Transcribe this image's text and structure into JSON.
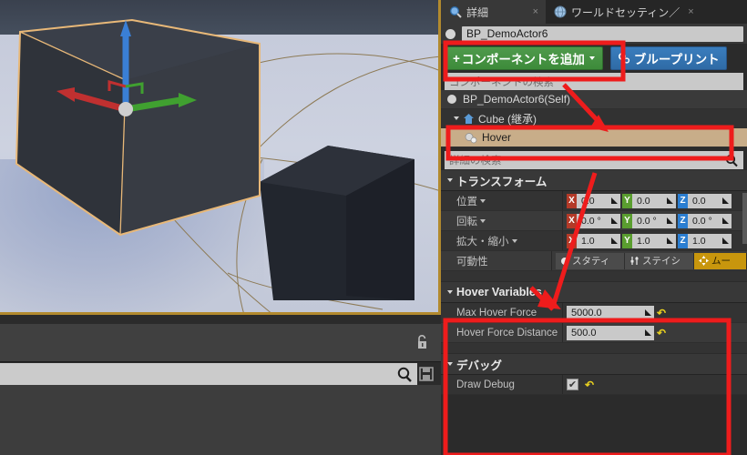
{
  "tabs": [
    {
      "label": "詳細",
      "icon": "details-magnifier-icon",
      "active": true,
      "close": "×"
    },
    {
      "label": "ワールドセッティン／",
      "icon": "globe-icon",
      "active": false,
      "close": "×"
    }
  ],
  "actor": {
    "name": "BP_DemoActor6",
    "icon": "sphere-icon"
  },
  "toolbar": {
    "add_component_label": "コンポーネントを追加",
    "add_component_plus": "+",
    "blueprint_label": "ブループリント",
    "blueprint_icon": "gears-icon"
  },
  "component_search_placeholder": "コンポーネントの検索",
  "component_tree": [
    {
      "label": "BP_DemoActor6(Self)",
      "icon": "sphere-icon",
      "level": "root",
      "selected": false
    },
    {
      "label": "Cube (継承)",
      "icon": "home-icon",
      "level": "child",
      "selected": false
    },
    {
      "label": "Hover",
      "icon": "spheres-icon",
      "level": "sub",
      "selected": true
    }
  ],
  "details_search_placeholder": "詳細の検索",
  "details_search_icon": "magnifier-icon",
  "sections": {
    "transform": {
      "title": "トランスフォーム",
      "rows": [
        {
          "label": "位置",
          "dropdown": true,
          "type": "vector",
          "axes": [
            {
              "axis": "X",
              "value": "0.0"
            },
            {
              "axis": "Y",
              "value": "0.0"
            },
            {
              "axis": "Z",
              "value": "0.0"
            }
          ]
        },
        {
          "label": "回転",
          "dropdown": true,
          "type": "vector",
          "axes": [
            {
              "axis": "X",
              "value": "0.0 °"
            },
            {
              "axis": "Y",
              "value": "0.0 °"
            },
            {
              "axis": "Z",
              "value": "0.0 °"
            }
          ]
        },
        {
          "label": "拡大・縮小",
          "dropdown": true,
          "type": "vector",
          "axes": [
            {
              "axis": "X",
              "value": "1.0"
            },
            {
              "axis": "Y",
              "value": "1.0"
            },
            {
              "axis": "Z",
              "value": "1.0"
            }
          ]
        }
      ],
      "mobility": {
        "label": "可動性",
        "options": [
          {
            "label": "スタティ",
            "icon": "dot-icon",
            "selected": false
          },
          {
            "label": "ステイシ",
            "icon": "sliders-icon",
            "selected": false
          },
          {
            "label": "ムー",
            "icon": "move-icon",
            "selected": true
          }
        ]
      }
    },
    "hover_variables": {
      "title": "Hover Variables",
      "rows": [
        {
          "label": "Max Hover Force",
          "value": "5000.0",
          "reset_icon": "reset-arrow-icon"
        },
        {
          "label": "Hover Force Distance",
          "value": "500.0",
          "reset_icon": "reset-arrow-icon"
        }
      ]
    },
    "debug": {
      "title": "デバッグ",
      "rows": [
        {
          "label": "Draw Debug",
          "checked": true,
          "check_glyph": "✔",
          "reset_icon": "reset-arrow-icon"
        }
      ]
    }
  },
  "viewport": {
    "selected_object_outline_color": "#e8b878",
    "gizmo_axis_colors": {
      "x": "#c03030",
      "y": "#40a030",
      "z": "#3a7fd5"
    }
  },
  "lower_left": {
    "lock_icon": "unlock-icon",
    "search_icon": "magnifier-icon",
    "save_icon": "save-disk-icon",
    "search_value": ""
  },
  "annotations": {
    "color": "#ee1c1c",
    "boxes": [
      "add-component-button",
      "hover-component-row",
      "hover-variables-and-debug"
    ],
    "arrows": [
      "arrow-to-component-tree",
      "arrow-to-hover-variables"
    ]
  }
}
